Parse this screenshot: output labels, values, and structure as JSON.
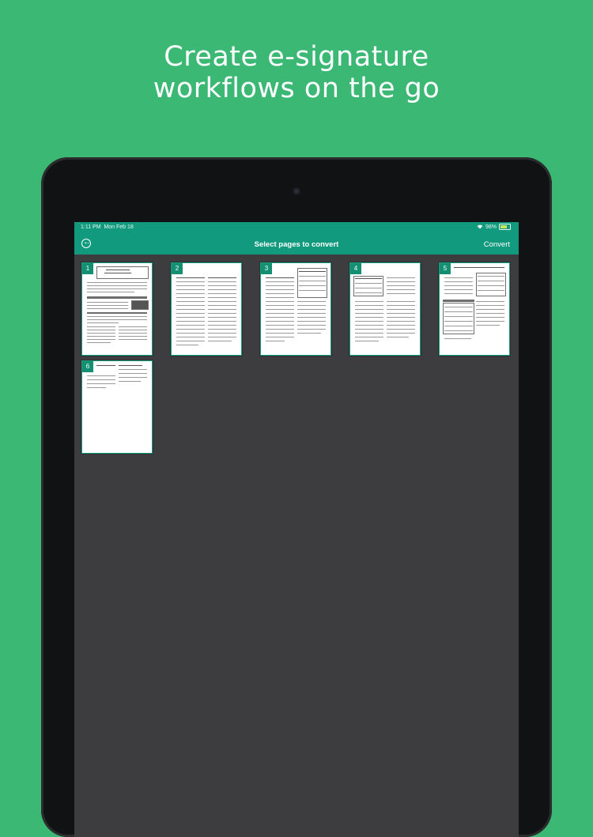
{
  "headline": {
    "line1": "Create e-signature",
    "line2": "workflows on the go"
  },
  "status_bar": {
    "time": "1:11 PM",
    "date": "Mon Feb 18",
    "battery": "98%",
    "icons": [
      "wifi-icon",
      "battery-icon"
    ]
  },
  "app_bar": {
    "back_icon": "back-arrow-circle-icon",
    "title": "Select pages to convert",
    "action_label": "Convert"
  },
  "pages": [
    {
      "number": "1"
    },
    {
      "number": "2"
    },
    {
      "number": "3"
    },
    {
      "number": "4"
    },
    {
      "number": "5"
    },
    {
      "number": "6"
    }
  ],
  "colors": {
    "background": "#3bb874",
    "app_bar": "#119a7e",
    "screen": "#3d3c3e",
    "badge": "#138f72"
  }
}
